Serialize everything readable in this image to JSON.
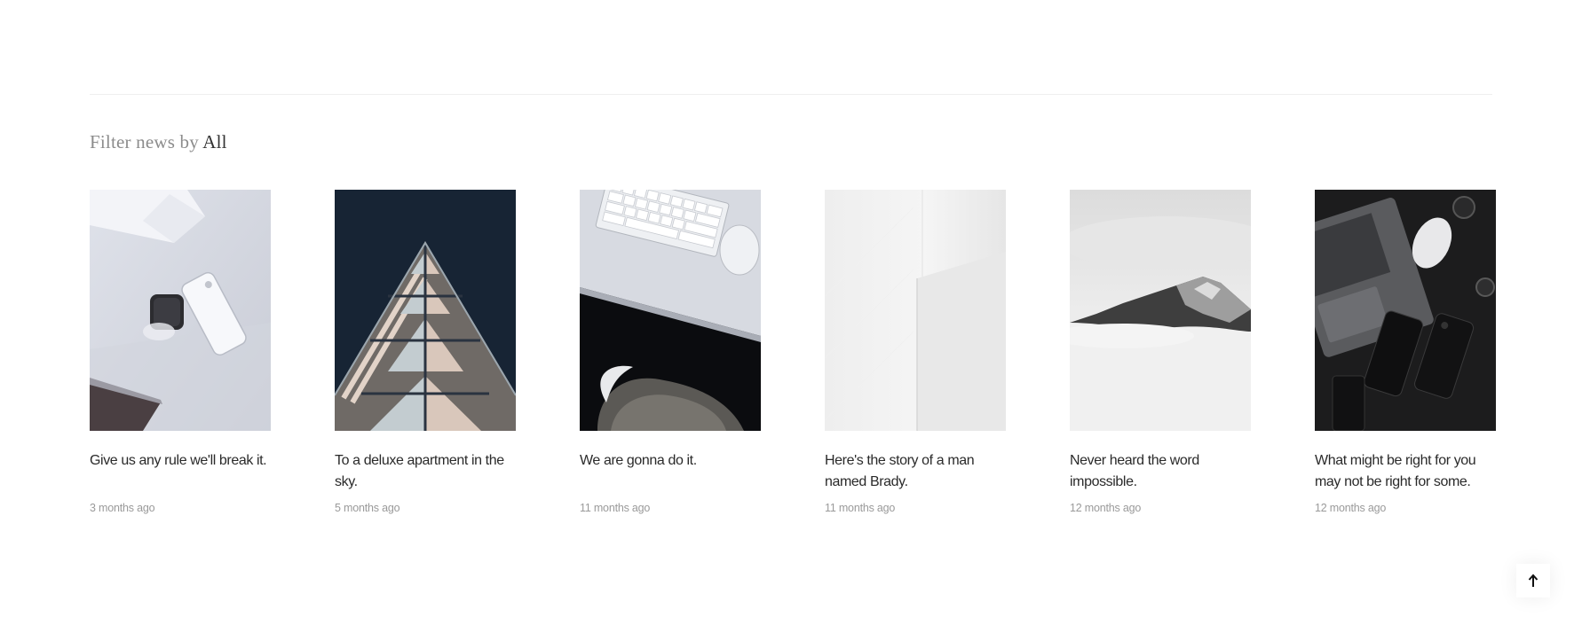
{
  "filter": {
    "label": "Filter news by",
    "value": "All"
  },
  "posts": [
    {
      "title": "Give us any rule we'll break it.",
      "date": "3 months ago",
      "thumb_icon": "devices-white-desk-photo"
    },
    {
      "title": "To a deluxe apartment in the sky.",
      "date": "5 months ago",
      "thumb_icon": "building-facade-photo"
    },
    {
      "title": "We are gonna do it.",
      "date": "11 months ago",
      "thumb_icon": "keyboard-mouse-desk-photo"
    },
    {
      "title": "Here's the story of a man named Brady.",
      "date": "11 months ago",
      "thumb_icon": "white-wall-photo"
    },
    {
      "title": "Never heard the word impossible.",
      "date": "12 months ago",
      "thumb_icon": "snowy-mountain-photo"
    },
    {
      "title": "What might be right for you may not be right for some.",
      "date": "12 months ago",
      "thumb_icon": "dark-devices-photo"
    }
  ],
  "back_to_top": {
    "icon": "arrow-up-icon"
  }
}
